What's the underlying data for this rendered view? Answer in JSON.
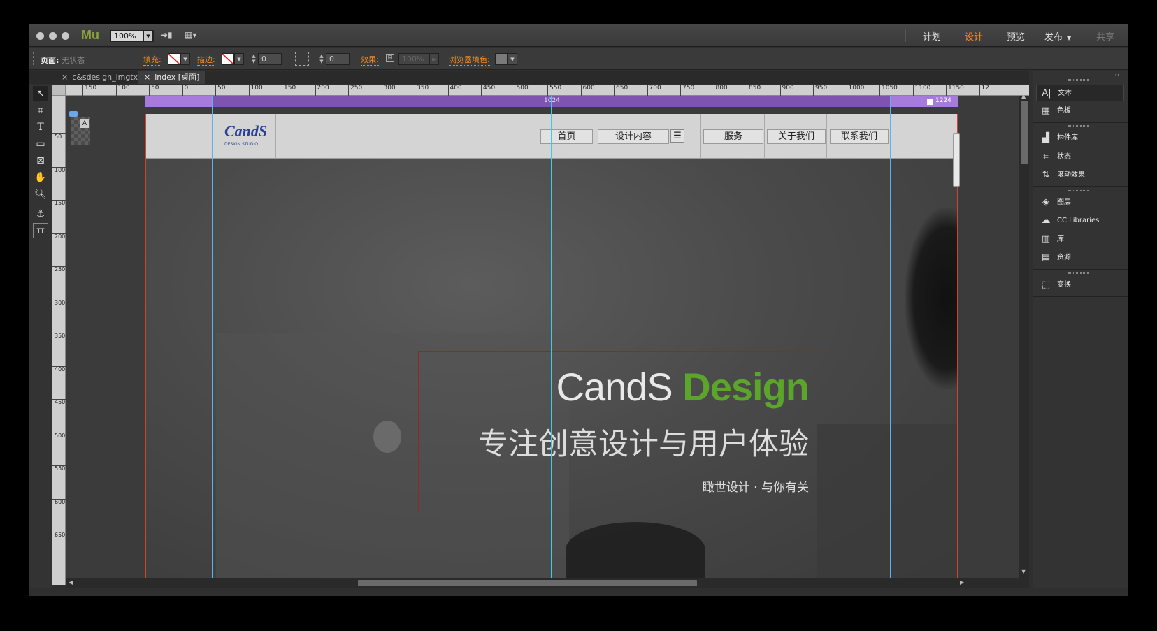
{
  "app": {
    "logo": "Mu",
    "zoom": "100%",
    "modes": [
      "计划",
      "设计",
      "预览",
      "发布",
      "共享"
    ],
    "active_mode": "设计",
    "accent": "#f08a24"
  },
  "controlbar": {
    "page_label": "页面:",
    "page_state": "无状态",
    "fill_label": "填充:",
    "stroke_label": "描边:",
    "stroke_value": "0",
    "corner_value": "0",
    "effects_label": "效果:",
    "opacity": "100%",
    "browser_fill_label": "浏览器填色:"
  },
  "tabs": [
    {
      "label": "c&sdesign_imgtxt"
    },
    {
      "label": "index [桌面]"
    }
  ],
  "ruler_h": [
    "150",
    "100",
    "50",
    "0",
    "50",
    "100",
    "150",
    "200",
    "250",
    "300",
    "350",
    "400",
    "450",
    "500",
    "550",
    "600",
    "650",
    "700",
    "750",
    "800",
    "850",
    "900",
    "950",
    "1000",
    "1050",
    "1100",
    "1150",
    "12"
  ],
  "ruler_v": [
    "50",
    "100",
    "150",
    "200",
    "250",
    "300",
    "350",
    "400",
    "450",
    "500",
    "550",
    "600",
    "650"
  ],
  "breakpoint": {
    "left_value": "1024",
    "right_value": "1224",
    "color": "#a77bdc"
  },
  "site": {
    "logo_text": "CandS",
    "logo_sub": "DESIGN STUDIO",
    "nav": [
      "首页",
      "设计内容",
      "服务",
      "关于我们",
      "联系我们"
    ],
    "hero_title_light": "CandS ",
    "hero_title_bold": "Design",
    "hero_title_bold_color": "#5aa52a",
    "hero_subtitle": "专注创意设计与用户体验",
    "hero_tagline": "瞰世设计 · 与你有关"
  },
  "panel": {
    "items": [
      {
        "label": "文本",
        "icon": "text-icon"
      },
      {
        "label": "色板",
        "icon": "swatches-icon"
      },
      {
        "label": "构件库",
        "icon": "widgets-icon"
      },
      {
        "label": "状态",
        "icon": "states-icon"
      },
      {
        "label": "滚动效果",
        "icon": "scroll-effects-icon"
      },
      {
        "label": "图层",
        "icon": "layers-icon"
      },
      {
        "label": "CC Libraries",
        "icon": "cc-libraries-icon"
      },
      {
        "label": "库",
        "icon": "library-icon"
      },
      {
        "label": "资源",
        "icon": "assets-icon"
      },
      {
        "label": "变换",
        "icon": "transform-icon"
      }
    ]
  }
}
